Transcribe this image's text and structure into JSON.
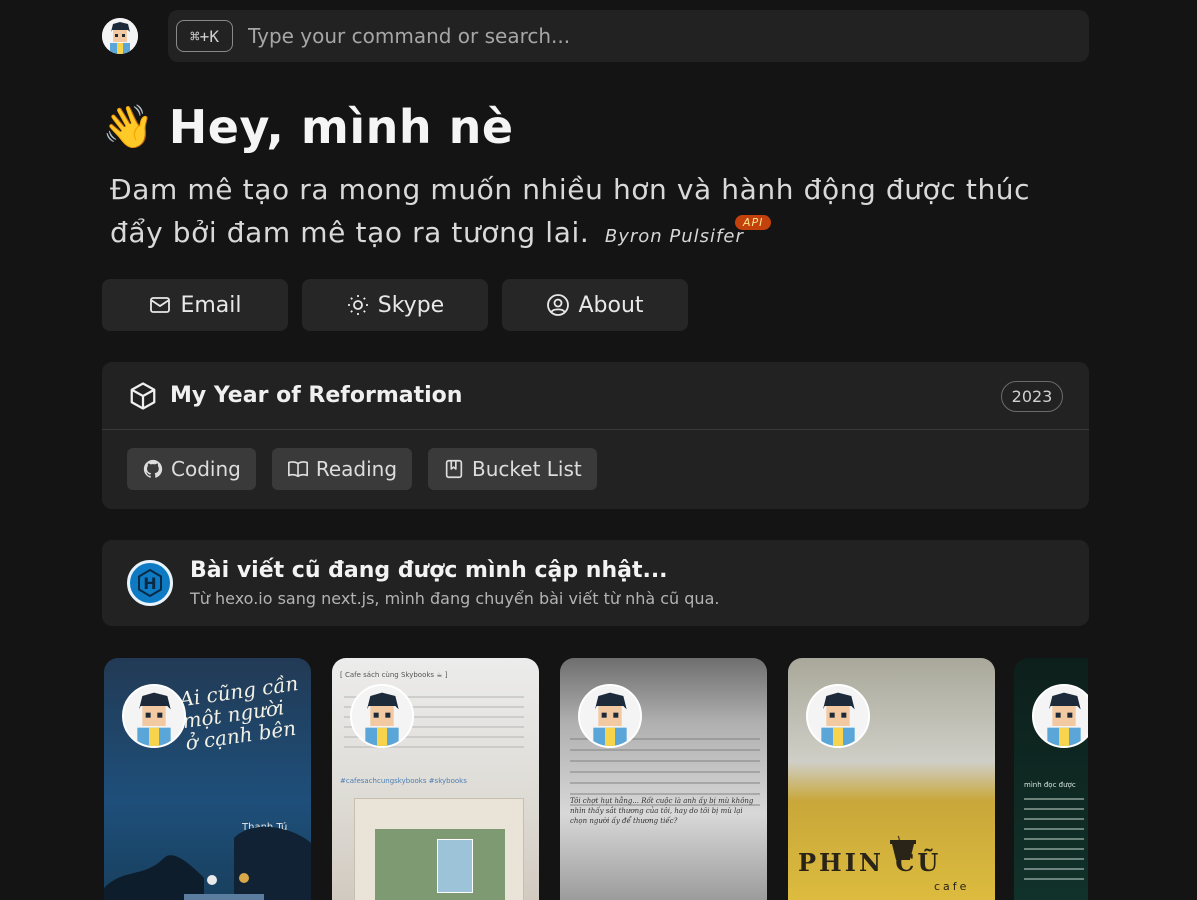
{
  "search": {
    "shortcut": "⌘+K",
    "placeholder": "Type your command or search..."
  },
  "hero": {
    "wave_emoji": "👋",
    "greeting": "Hey, mình nè",
    "quote": "Đam mê tạo ra mong muốn nhiều hơn và hành động được thúc đẩy bởi đam mê tạo ra tương lai.",
    "author": "Byron Pulsifer",
    "api_badge": "API"
  },
  "contact": [
    {
      "label": "Email",
      "icon": "mail-icon"
    },
    {
      "label": "Skype",
      "icon": "sun-icon"
    },
    {
      "label": "About",
      "icon": "user-circle-icon"
    }
  ],
  "reformation": {
    "icon": "cube-icon",
    "title": "My Year of Reformation",
    "year": "2023",
    "tabs": [
      {
        "label": "Coding",
        "icon": "github-icon"
      },
      {
        "label": "Reading",
        "icon": "book-open-icon"
      },
      {
        "label": "Bucket List",
        "icon": "bookmark-book-icon"
      }
    ]
  },
  "hexo": {
    "logo": "H",
    "title": "Bài viết cũ đang được mình cập nhật...",
    "subtitle": "Từ hexo.io sang next.js, mình đang chuyển bài viết từ nhà cũ qua."
  },
  "stories": {
    "s1": {
      "cover_title": "Ai cũng cần một người ở cạnh bên",
      "author": "Thanh Tú"
    },
    "s2": {
      "header": "[ Cafe sách cùng Skybooks ☕ ]",
      "tags": "#cafesachcungskybooks #skybooks"
    },
    "s3": {
      "caption": "Tôi chợt hụt hẫng... Rốt cuộc là anh ấy bị mù không nhìn thấy sắt thương của tôi, hay do tôi bị mù lại chọn người ấy để thương tiếc?"
    },
    "s4": {
      "sign": "PHIN CŨ",
      "sign_sub": "cafe"
    },
    "s5": {
      "text": "mình đọc được"
    }
  },
  "colors": {
    "background": "#141414",
    "card": "#222222",
    "button": "#262626",
    "accent": "#c2410c",
    "hexo_blue": "#0e7ac4"
  }
}
